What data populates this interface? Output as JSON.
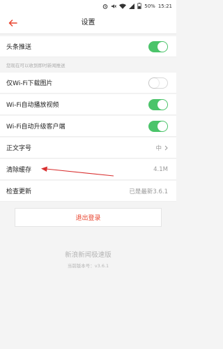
{
  "status_bar": {
    "battery": "50%",
    "time": "15:21",
    "icons": [
      "alarm-icon",
      "mute-icon",
      "wifi-icon",
      "signal-icon",
      "battery-icon"
    ]
  },
  "header": {
    "title": "设置",
    "back_icon": "back-arrow-icon"
  },
  "settings": {
    "headline_push": {
      "label": "头条推送",
      "enabled": true
    },
    "push_hint": "您现在可以收到即时新闻推送",
    "wifi_images": {
      "label": "仅Wi-Fi下载图片",
      "enabled": false
    },
    "wifi_autoplay": {
      "label": "Wi-Fi自动播放视频",
      "enabled": true
    },
    "wifi_upgrade": {
      "label": "Wi-Fi自动升级客户端",
      "enabled": true
    },
    "font_size": {
      "label": "正文字号",
      "value": "中"
    },
    "clear_cache": {
      "label": "清除缓存",
      "value": "4.1M"
    },
    "check_update": {
      "label": "检查更新",
      "value": "已是最新3.6.1"
    }
  },
  "logout_label": "退出登录",
  "footer": {
    "app_name": "新浪新闻极速版",
    "version": "当前版本号：v3.6.1"
  },
  "colors": {
    "accent": "#e8432d",
    "toggle_on": "#4bc46a",
    "annotation": "#d93030"
  }
}
